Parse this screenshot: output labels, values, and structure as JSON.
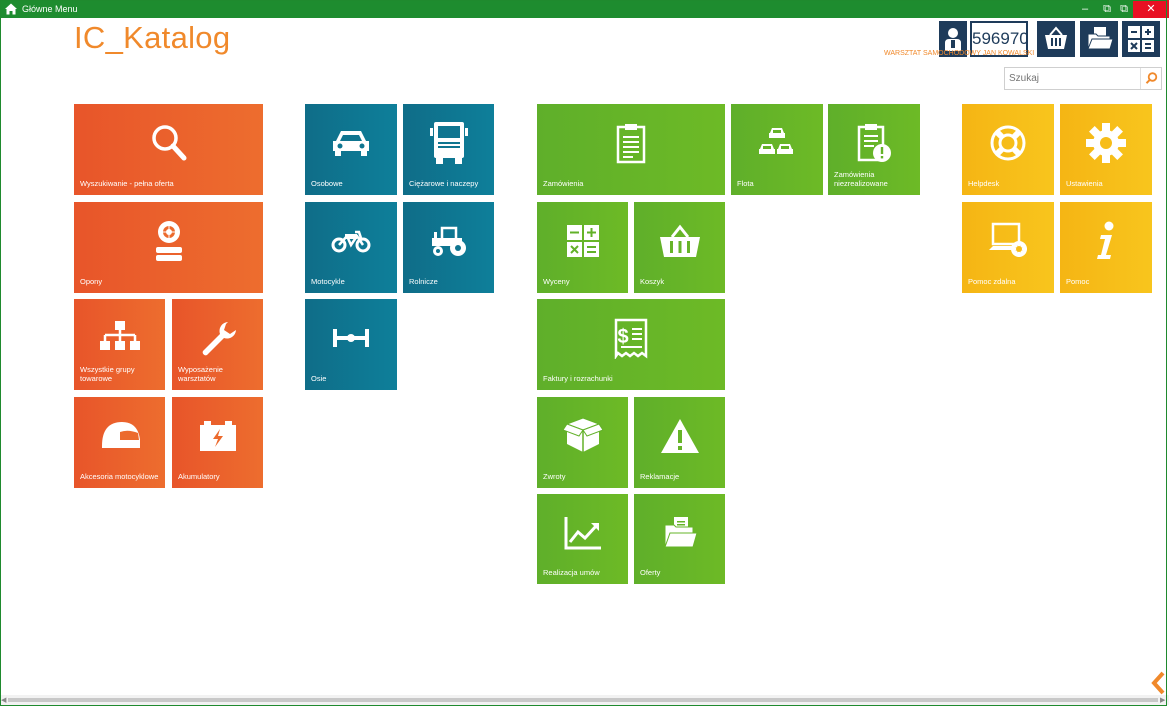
{
  "window": {
    "title": "Główne Menu",
    "controls": {
      "minimize": "–",
      "restore1": "⧉",
      "restore2": "⧉",
      "close": "✕"
    }
  },
  "header": {
    "app_title": "IC_Katalog",
    "user_number": "596970",
    "user_name": "WARSZTAT SAMOCHODOWY JAN KOWALSKI",
    "search_placeholder": "Szukaj",
    "accent_color": "#f0892b",
    "button_color": "#1e3b5a"
  },
  "tiles": {
    "orange": [
      {
        "label": "Wyszukiwanie - pełna oferta",
        "icon": "search-icon"
      },
      {
        "label": "Opony",
        "icon": "tires-icon"
      },
      {
        "label": "Wszystkie grupy towarowe",
        "icon": "hierarchy-icon"
      },
      {
        "label": "Wyposażenie warsztatów",
        "icon": "wrench-icon"
      },
      {
        "label": "Akcesoria motocyklowe",
        "icon": "helmet-icon"
      },
      {
        "label": "Akumulatory",
        "icon": "battery-icon"
      }
    ],
    "teal": [
      {
        "label": "Osobowe",
        "icon": "car-icon"
      },
      {
        "label": "Ciężarowe i naczepy",
        "icon": "truck-icon"
      },
      {
        "label": "Motocykle",
        "icon": "motorcycle-icon"
      },
      {
        "label": "Rolnicze",
        "icon": "tractor-icon"
      },
      {
        "label": "Osie",
        "icon": "axle-icon"
      }
    ],
    "green": [
      {
        "label": "Zamówienia",
        "icon": "clipboard-icon"
      },
      {
        "label": "Flota",
        "icon": "fleet-icon"
      },
      {
        "label": "Zamówienia niezrealizowane",
        "icon": "clipboard-alert-icon"
      },
      {
        "label": "Wyceny",
        "icon": "calculator-icon"
      },
      {
        "label": "Koszyk",
        "icon": "basket-icon"
      },
      {
        "label": "Faktury i rozrachunki",
        "icon": "invoice-icon"
      },
      {
        "label": "Zwroty",
        "icon": "box-icon"
      },
      {
        "label": "Reklamacje",
        "icon": "warning-icon"
      },
      {
        "label": "Realizacja umów",
        "icon": "chart-icon"
      },
      {
        "label": "Oferty",
        "icon": "folder-icon"
      }
    ],
    "yellow": [
      {
        "label": "Helpdesk",
        "icon": "lifebuoy-icon"
      },
      {
        "label": "Ustawienia",
        "icon": "gear-icon"
      },
      {
        "label": "Pomoc zdalna",
        "icon": "remote-help-icon"
      },
      {
        "label": "Pomoc",
        "icon": "info-icon"
      }
    ]
  },
  "tile_colors": {
    "orange": "#e8552a",
    "teal": "#0f6d88",
    "green": "#5faf2a",
    "yellow": "#f5b514"
  }
}
